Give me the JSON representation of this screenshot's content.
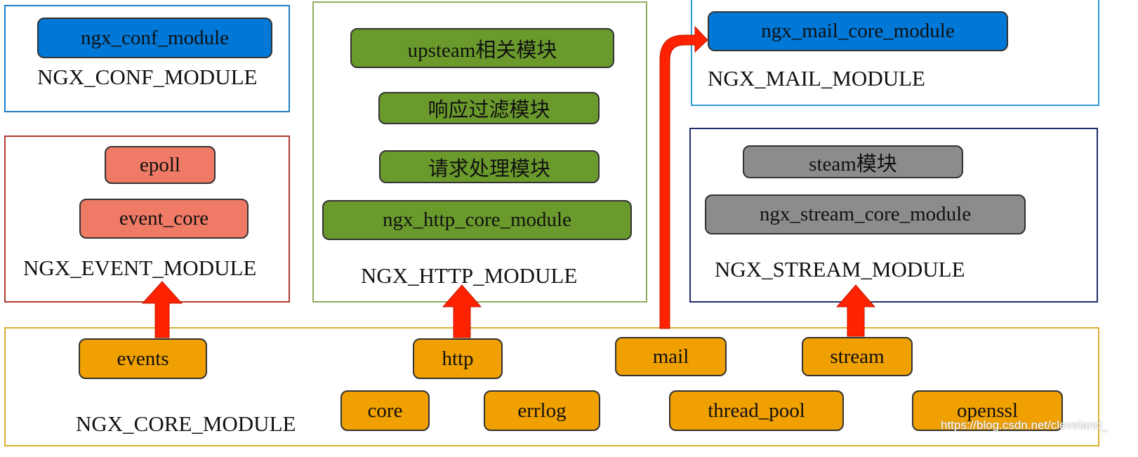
{
  "colors": {
    "conf": "#0078d7",
    "event": "#ef7a66",
    "http": "#6b9a2c",
    "stream": "#8c8c8c",
    "core": "#f0a000",
    "arrow": "#ff2200"
  },
  "conf": {
    "label": "NGX_CONF_MODULE",
    "items": [
      "ngx_conf_module"
    ]
  },
  "event": {
    "label": "NGX_EVENT_MODULE",
    "items": [
      "epoll",
      "event_core"
    ]
  },
  "http": {
    "label": "NGX_HTTP_MODULE",
    "items": [
      "upsteam相关模块",
      "响应过滤模块",
      "请求处理模块",
      "ngx_http_core_module"
    ]
  },
  "mail": {
    "label": "NGX_MAIL_MODULE",
    "items": [
      "ngx_mail_core_module"
    ]
  },
  "stream": {
    "label": "NGX_STREAM_MODULE",
    "items": [
      "steam模块",
      "ngx_stream_core_module"
    ]
  },
  "core": {
    "label": "NGX_CORE_MODULE",
    "items": [
      "events",
      "http",
      "mail",
      "stream",
      "core",
      "errlog",
      "thread_pool",
      "openssl"
    ]
  },
  "watermark": "https://blog.csdn.net/cleveland_"
}
